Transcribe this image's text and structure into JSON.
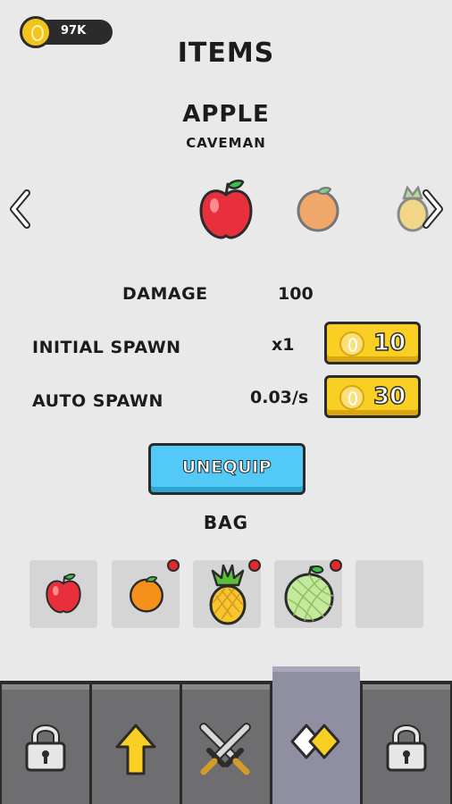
{
  "currency": {
    "amount": "97K",
    "icon": "coin-icon"
  },
  "page": {
    "title": "ITEMS"
  },
  "selected_item": {
    "name": "APPLE",
    "subtitle": "CAVEMAN"
  },
  "carousel": {
    "prev_icon": "chevron-left-icon",
    "next_icon": "chevron-right-icon",
    "items": [
      "apple",
      "orange",
      "pineapple"
    ]
  },
  "stats": {
    "damage": {
      "label": "DAMAGE",
      "value": "100"
    },
    "initial_spawn": {
      "label": "INITIAL SPAWN",
      "value": "x1",
      "price": "10"
    },
    "auto_spawn": {
      "label": "AUTO SPAWN",
      "value": "0.03/s",
      "price": "30"
    }
  },
  "actions": {
    "unequip_label": "UNEQUIP"
  },
  "bag": {
    "title": "BAG",
    "slots": [
      {
        "item": "apple",
        "new": false
      },
      {
        "item": "orange",
        "new": true
      },
      {
        "item": "pineapple",
        "new": true
      },
      {
        "item": "melon",
        "new": true
      },
      {
        "item": "empty",
        "new": false
      }
    ]
  },
  "tabs": [
    {
      "icon": "lock-icon",
      "active": false
    },
    {
      "icon": "upgrade-arrow-icon",
      "active": false
    },
    {
      "icon": "crossed-swords-icon",
      "active": false
    },
    {
      "icon": "items-icon",
      "active": true
    },
    {
      "icon": "lock-icon",
      "active": false
    }
  ],
  "colors": {
    "background": "#e9e9e9",
    "accent_yellow": "#f8cf22",
    "accent_blue": "#52c9f6",
    "tab_active": "#8f8fa1",
    "tab_inactive": "#6e6e70"
  }
}
